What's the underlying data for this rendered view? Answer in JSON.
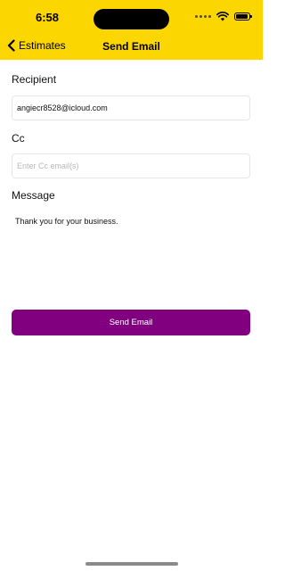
{
  "status_bar": {
    "time": "6:58"
  },
  "nav": {
    "back_label": "Estimates",
    "title": "Send Email"
  },
  "form": {
    "recipient_label": "Recipient",
    "recipient_value": "angiecr8528@icloud.com",
    "cc_label": "Cc",
    "cc_value": "",
    "cc_placeholder": "Enter Cc email(s)",
    "message_label": "Message",
    "message_value": "Thank you for your business."
  },
  "actions": {
    "send_label": "Send Email"
  },
  "colors": {
    "header_bg": "#FCD600",
    "button_bg": "#800080"
  }
}
